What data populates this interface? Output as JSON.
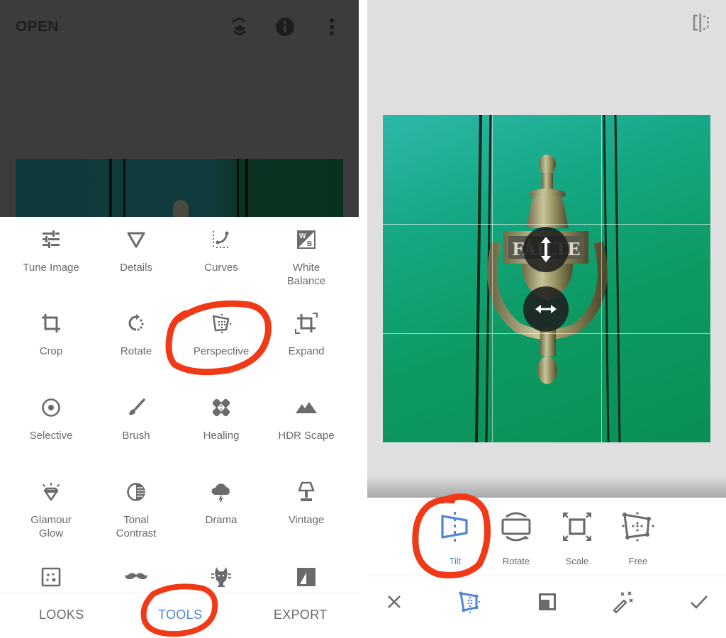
{
  "left_screen": {
    "header": {
      "open_label": "OPEN",
      "icons": [
        "undo-layers-icon",
        "info-icon",
        "more-vert-icon"
      ]
    },
    "tools": [
      {
        "label": "Tune Image",
        "icon": "tune-sliders-icon"
      },
      {
        "label": "Details",
        "icon": "details-triangle-icon"
      },
      {
        "label": "Curves",
        "icon": "curves-icon"
      },
      {
        "label": "White\nBalance",
        "icon": "white-balance-icon"
      },
      {
        "label": "Crop",
        "icon": "crop-icon"
      },
      {
        "label": "Rotate",
        "icon": "rotate-icon"
      },
      {
        "label": "Perspective",
        "icon": "perspective-icon"
      },
      {
        "label": "Expand",
        "icon": "expand-icon"
      },
      {
        "label": "Selective",
        "icon": "selective-icon"
      },
      {
        "label": "Brush",
        "icon": "brush-icon"
      },
      {
        "label": "Healing",
        "icon": "healing-bandage-icon"
      },
      {
        "label": "HDR Scape",
        "icon": "mountains-icon"
      },
      {
        "label": "Glamour\nGlow",
        "icon": "diamond-glow-icon"
      },
      {
        "label": "Tonal\nContrast",
        "icon": "tonal-contrast-icon"
      },
      {
        "label": "Drama",
        "icon": "storm-cloud-icon"
      },
      {
        "label": "Vintage",
        "icon": "lamp-icon"
      },
      {
        "label": "",
        "icon": "grainy-film-icon"
      },
      {
        "label": "",
        "icon": "mustache-icon"
      },
      {
        "label": "",
        "icon": "guitar-head-icon"
      },
      {
        "label": "",
        "icon": "noir-icon"
      }
    ],
    "bottom_tabs": [
      {
        "label": "LOOKS",
        "active": false
      },
      {
        "label": "TOOLS",
        "active": true
      },
      {
        "label": "EXPORT",
        "active": false
      }
    ]
  },
  "right_screen": {
    "compare_icon": "compare-split-icon",
    "handles": [
      "vertical-tilt-handle",
      "horizontal-tilt-handle"
    ],
    "sub_tools": [
      {
        "label": "Tilt",
        "active": true,
        "icon": "tilt-icon"
      },
      {
        "label": "Rotate",
        "active": false,
        "icon": "rotate-frame-icon"
      },
      {
        "label": "Scale",
        "active": false,
        "icon": "scale-icon"
      },
      {
        "label": "Free",
        "active": false,
        "icon": "free-perspective-icon"
      }
    ],
    "actions": [
      "close-icon",
      "perspective-icon",
      "fill-icon",
      "auto-fill-wand-icon",
      "check-icon"
    ]
  },
  "colors": {
    "accent": "#4f86d6",
    "annotation": "#f03a17",
    "text_gray": "#6a6a6a",
    "dim_overlay": "#3c3c3c",
    "canvas_bg": "#dfdfdf"
  }
}
